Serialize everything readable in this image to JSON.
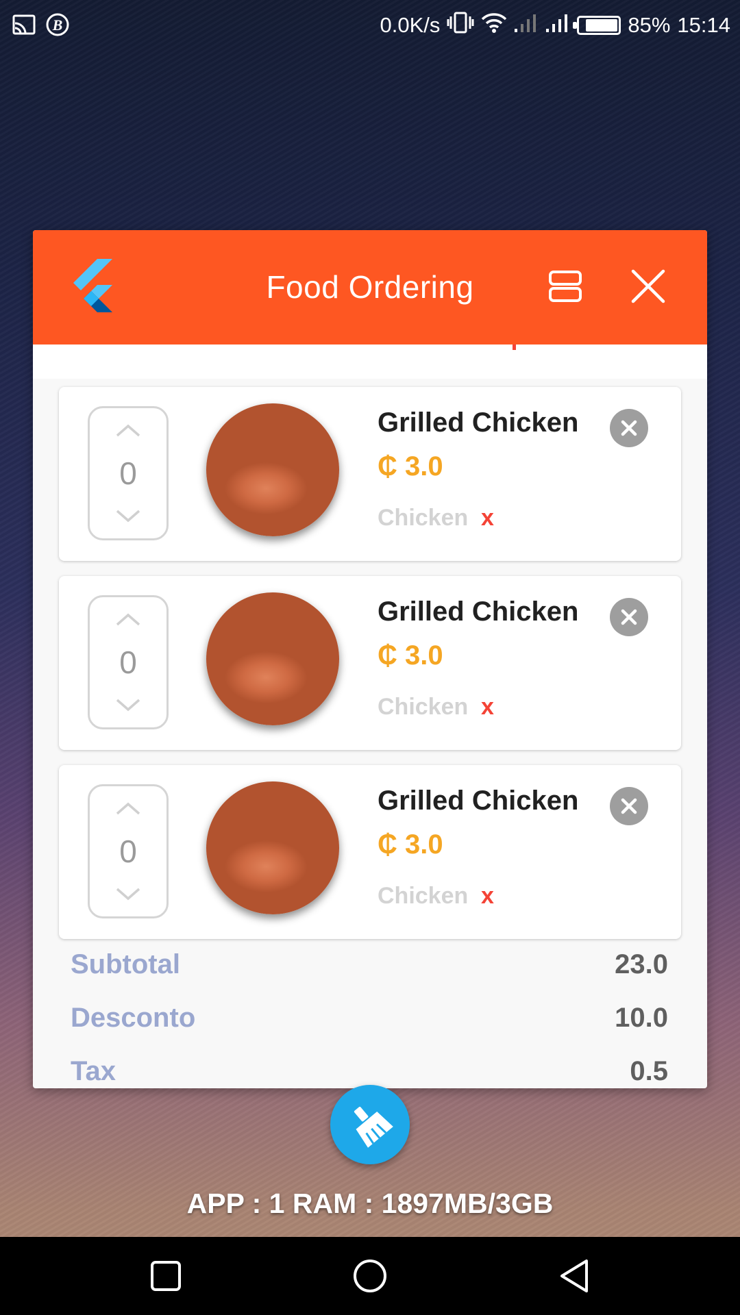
{
  "status_bar": {
    "speed": "0.0K/s",
    "battery": "85%",
    "battery_level": 0.85,
    "time": "15:14",
    "icons": [
      "cast-icon",
      "b-badge-icon",
      "vibrate-icon",
      "wifi-icon",
      "signal-icon",
      "signal-icon",
      "battery-icon"
    ]
  },
  "app": {
    "title": "Food Ordering",
    "accent": "#fe5722",
    "logo": "flutter-logo",
    "toggle_icon": "view-agenda-icon",
    "close_icon": "close-icon"
  },
  "cart_items": [
    {
      "qty": "0",
      "name": "Grilled Chicken",
      "price": "₵ 3.0",
      "tag": "Chicken",
      "tag_remove": "x"
    },
    {
      "qty": "0",
      "name": "Grilled Chicken",
      "price": "₵ 3.0",
      "tag": "Chicken",
      "tag_remove": "x"
    },
    {
      "qty": "0",
      "name": "Grilled Chicken",
      "price": "₵ 3.0",
      "tag": "Chicken",
      "tag_remove": "x"
    }
  ],
  "summary": [
    {
      "label": "Subtotal",
      "value": "23.0"
    },
    {
      "label": "Desconto",
      "value": "10.0"
    },
    {
      "label": "Tax",
      "value": "0.5"
    }
  ],
  "fab": {
    "icon": "broom-clean-icon",
    "color": "#1ea8e9"
  },
  "overlay_text": "APP : 1 RAM : 1897MB/3GB",
  "nav": {
    "icons": [
      "recents-square-icon",
      "home-circle-icon",
      "back-triangle-icon"
    ]
  }
}
